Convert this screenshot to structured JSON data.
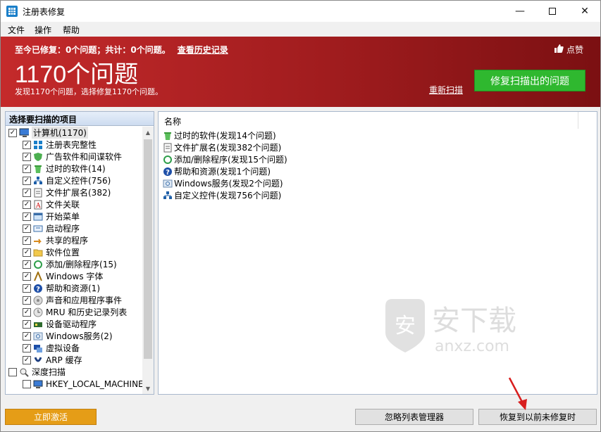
{
  "window": {
    "title": "注册表修复"
  },
  "menu": [
    "文件",
    "操作",
    "帮助"
  ],
  "banner": {
    "summary": "至今已修复：0个问题；共计：0个问题。",
    "history_link": "查看历史记录",
    "like": "点赞",
    "count_text": "1170个问题",
    "sub_text": "发现1170个问题，选择修复1170个问题。",
    "rescan": "重新扫描",
    "fix_button": "修复扫描出的问题"
  },
  "left_panel": {
    "header": "选择要扫描的项目",
    "items": [
      {
        "label": "计算机(1170)",
        "level": 0,
        "checked": true,
        "icon": "computer-icon",
        "selected": true
      },
      {
        "label": "注册表完整性",
        "level": 1,
        "checked": true,
        "icon": "registry-icon"
      },
      {
        "label": "广告软件和间谍软件",
        "level": 1,
        "checked": true,
        "icon": "shield-icon"
      },
      {
        "label": "过时的软件(14)",
        "level": 1,
        "checked": true,
        "icon": "trash-icon"
      },
      {
        "label": "自定义控件(756)",
        "level": 1,
        "checked": true,
        "icon": "controls-icon"
      },
      {
        "label": "文件扩展名(382)",
        "level": 1,
        "checked": true,
        "icon": "file-ext-icon"
      },
      {
        "label": "文件关联",
        "level": 1,
        "checked": true,
        "icon": "file-assoc-icon"
      },
      {
        "label": "开始菜单",
        "level": 1,
        "checked": true,
        "icon": "start-menu-icon"
      },
      {
        "label": "启动程序",
        "level": 1,
        "checked": true,
        "icon": "startup-icon"
      },
      {
        "label": "共享的程序",
        "level": 1,
        "checked": true,
        "icon": "shared-icon"
      },
      {
        "label": "软件位置",
        "level": 1,
        "checked": true,
        "icon": "folder-icon"
      },
      {
        "label": "添加/删除程序(15)",
        "level": 1,
        "checked": true,
        "icon": "recycle-icon"
      },
      {
        "label": "Windows 字体",
        "level": 1,
        "checked": true,
        "icon": "font-icon"
      },
      {
        "label": "帮助和资源(1)",
        "level": 1,
        "checked": true,
        "icon": "help-icon"
      },
      {
        "label": "声音和应用程序事件",
        "level": 1,
        "checked": true,
        "icon": "sound-icon"
      },
      {
        "label": "MRU 和历史记录列表",
        "level": 1,
        "checked": true,
        "icon": "history-icon"
      },
      {
        "label": "设备驱动程序",
        "level": 1,
        "checked": true,
        "icon": "driver-icon"
      },
      {
        "label": "Windows服务(2)",
        "level": 1,
        "checked": true,
        "icon": "services-icon"
      },
      {
        "label": "虚拟设备",
        "level": 1,
        "checked": true,
        "icon": "virtual-device-icon"
      },
      {
        "label": "ARP 缓存",
        "level": 1,
        "checked": true,
        "icon": "arp-icon"
      },
      {
        "label": "深度扫描",
        "level": 0,
        "checked": false,
        "icon": "deep-scan-icon"
      },
      {
        "label": "HKEY_LOCAL_MACHINE",
        "level": 1,
        "checked": false,
        "icon": "hklm-icon"
      }
    ]
  },
  "right_panel": {
    "column_header": "名称",
    "rows": [
      {
        "label": "过时的软件(发现14个问题)",
        "icon": "trash-icon"
      },
      {
        "label": "文件扩展名(发现382个问题)",
        "icon": "file-ext-icon"
      },
      {
        "label": "添加/删除程序(发现15个问题)",
        "icon": "recycle-icon"
      },
      {
        "label": "帮助和资源(发现1个问题)",
        "icon": "help-icon"
      },
      {
        "label": "Windows服务(发现2个问题)",
        "icon": "services-icon"
      },
      {
        "label": "自定义控件(发现756个问题)",
        "icon": "controls-icon"
      }
    ]
  },
  "watermark": {
    "cn": "安下载",
    "en": "anxz.com"
  },
  "bottom": {
    "activate": "立即激活",
    "ignore_manager": "忽略列表管理器",
    "restore": "恢复到以前未修复时"
  }
}
